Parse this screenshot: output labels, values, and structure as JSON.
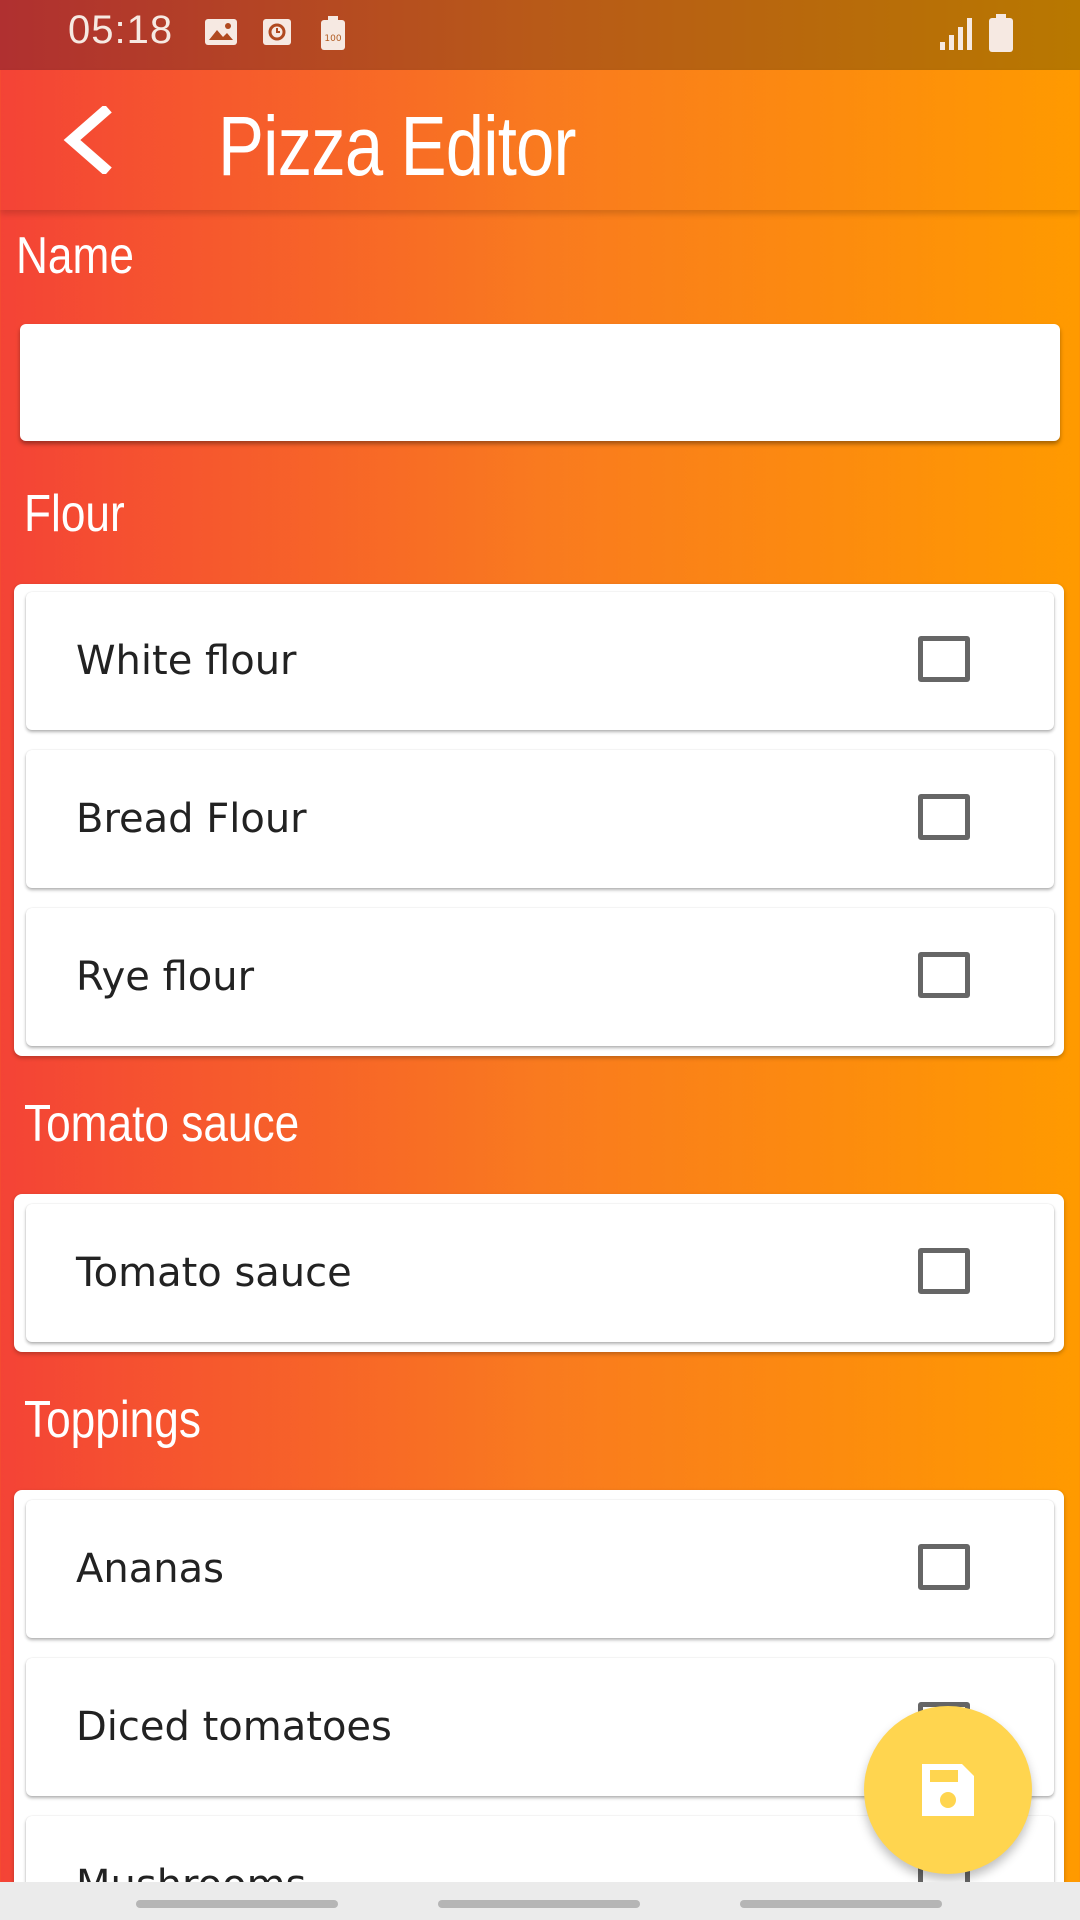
{
  "status_bar": {
    "time": "05:18"
  },
  "app_bar": {
    "title": "Pizza Editor"
  },
  "name_section": {
    "label": "Name",
    "input_value": "",
    "placeholder": ""
  },
  "flour_section": {
    "label": "Flour",
    "items": [
      {
        "label": "White flour",
        "checked": false
      },
      {
        "label": "Bread Flour",
        "checked": false
      },
      {
        "label": "Rye flour",
        "checked": false
      }
    ]
  },
  "tomato_section": {
    "label": "Tomato sauce",
    "items": [
      {
        "label": "Tomato sauce",
        "checked": false
      }
    ]
  },
  "toppings_section": {
    "label": "Toppings",
    "items": [
      {
        "label": "Ananas",
        "checked": false
      },
      {
        "label": "Diced tomatoes",
        "checked": false
      },
      {
        "label": "Mushrooms",
        "checked": false
      }
    ]
  },
  "fab": {
    "icon": "save-icon",
    "color": "#ffd54f"
  },
  "colors": {
    "gradient_start": "#f44336",
    "gradient_end": "#ff9a00",
    "checkbox_border": "#666666"
  }
}
